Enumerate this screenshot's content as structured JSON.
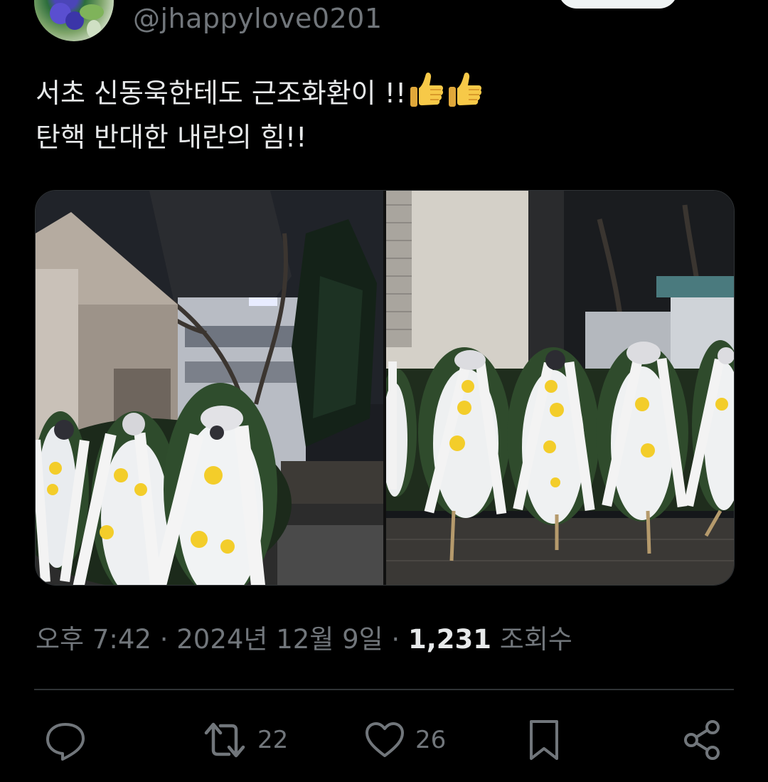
{
  "header": {
    "handle": "@jhappylove0201"
  },
  "tweet": {
    "line1": "서초 신동욱한테도 근조화환이 !!",
    "line2": "탄핵 반대한 내란의 힘!!",
    "emoji": [
      "thumbs-up",
      "thumbs-up"
    ]
  },
  "media": {
    "count": 2,
    "photos": [
      "wreaths-left-photo",
      "wreaths-right-photo"
    ]
  },
  "meta": {
    "time": "오후 7:42",
    "sep1": " · ",
    "date": "2024년 12월 9일",
    "sep2": " · ",
    "views_count": "1,231",
    "views_label": " 조회수"
  },
  "actions": {
    "reply_icon": "reply-icon",
    "retweet_icon": "retweet-icon",
    "retweet_count": "22",
    "like_icon": "heart-icon",
    "like_count": "26",
    "bookmark_icon": "bookmark-icon",
    "share_icon": "share-icon"
  },
  "colors": {
    "background": "#000000",
    "text_primary": "#e7e9ea",
    "text_secondary": "#71767b",
    "divider": "#2f3336"
  }
}
